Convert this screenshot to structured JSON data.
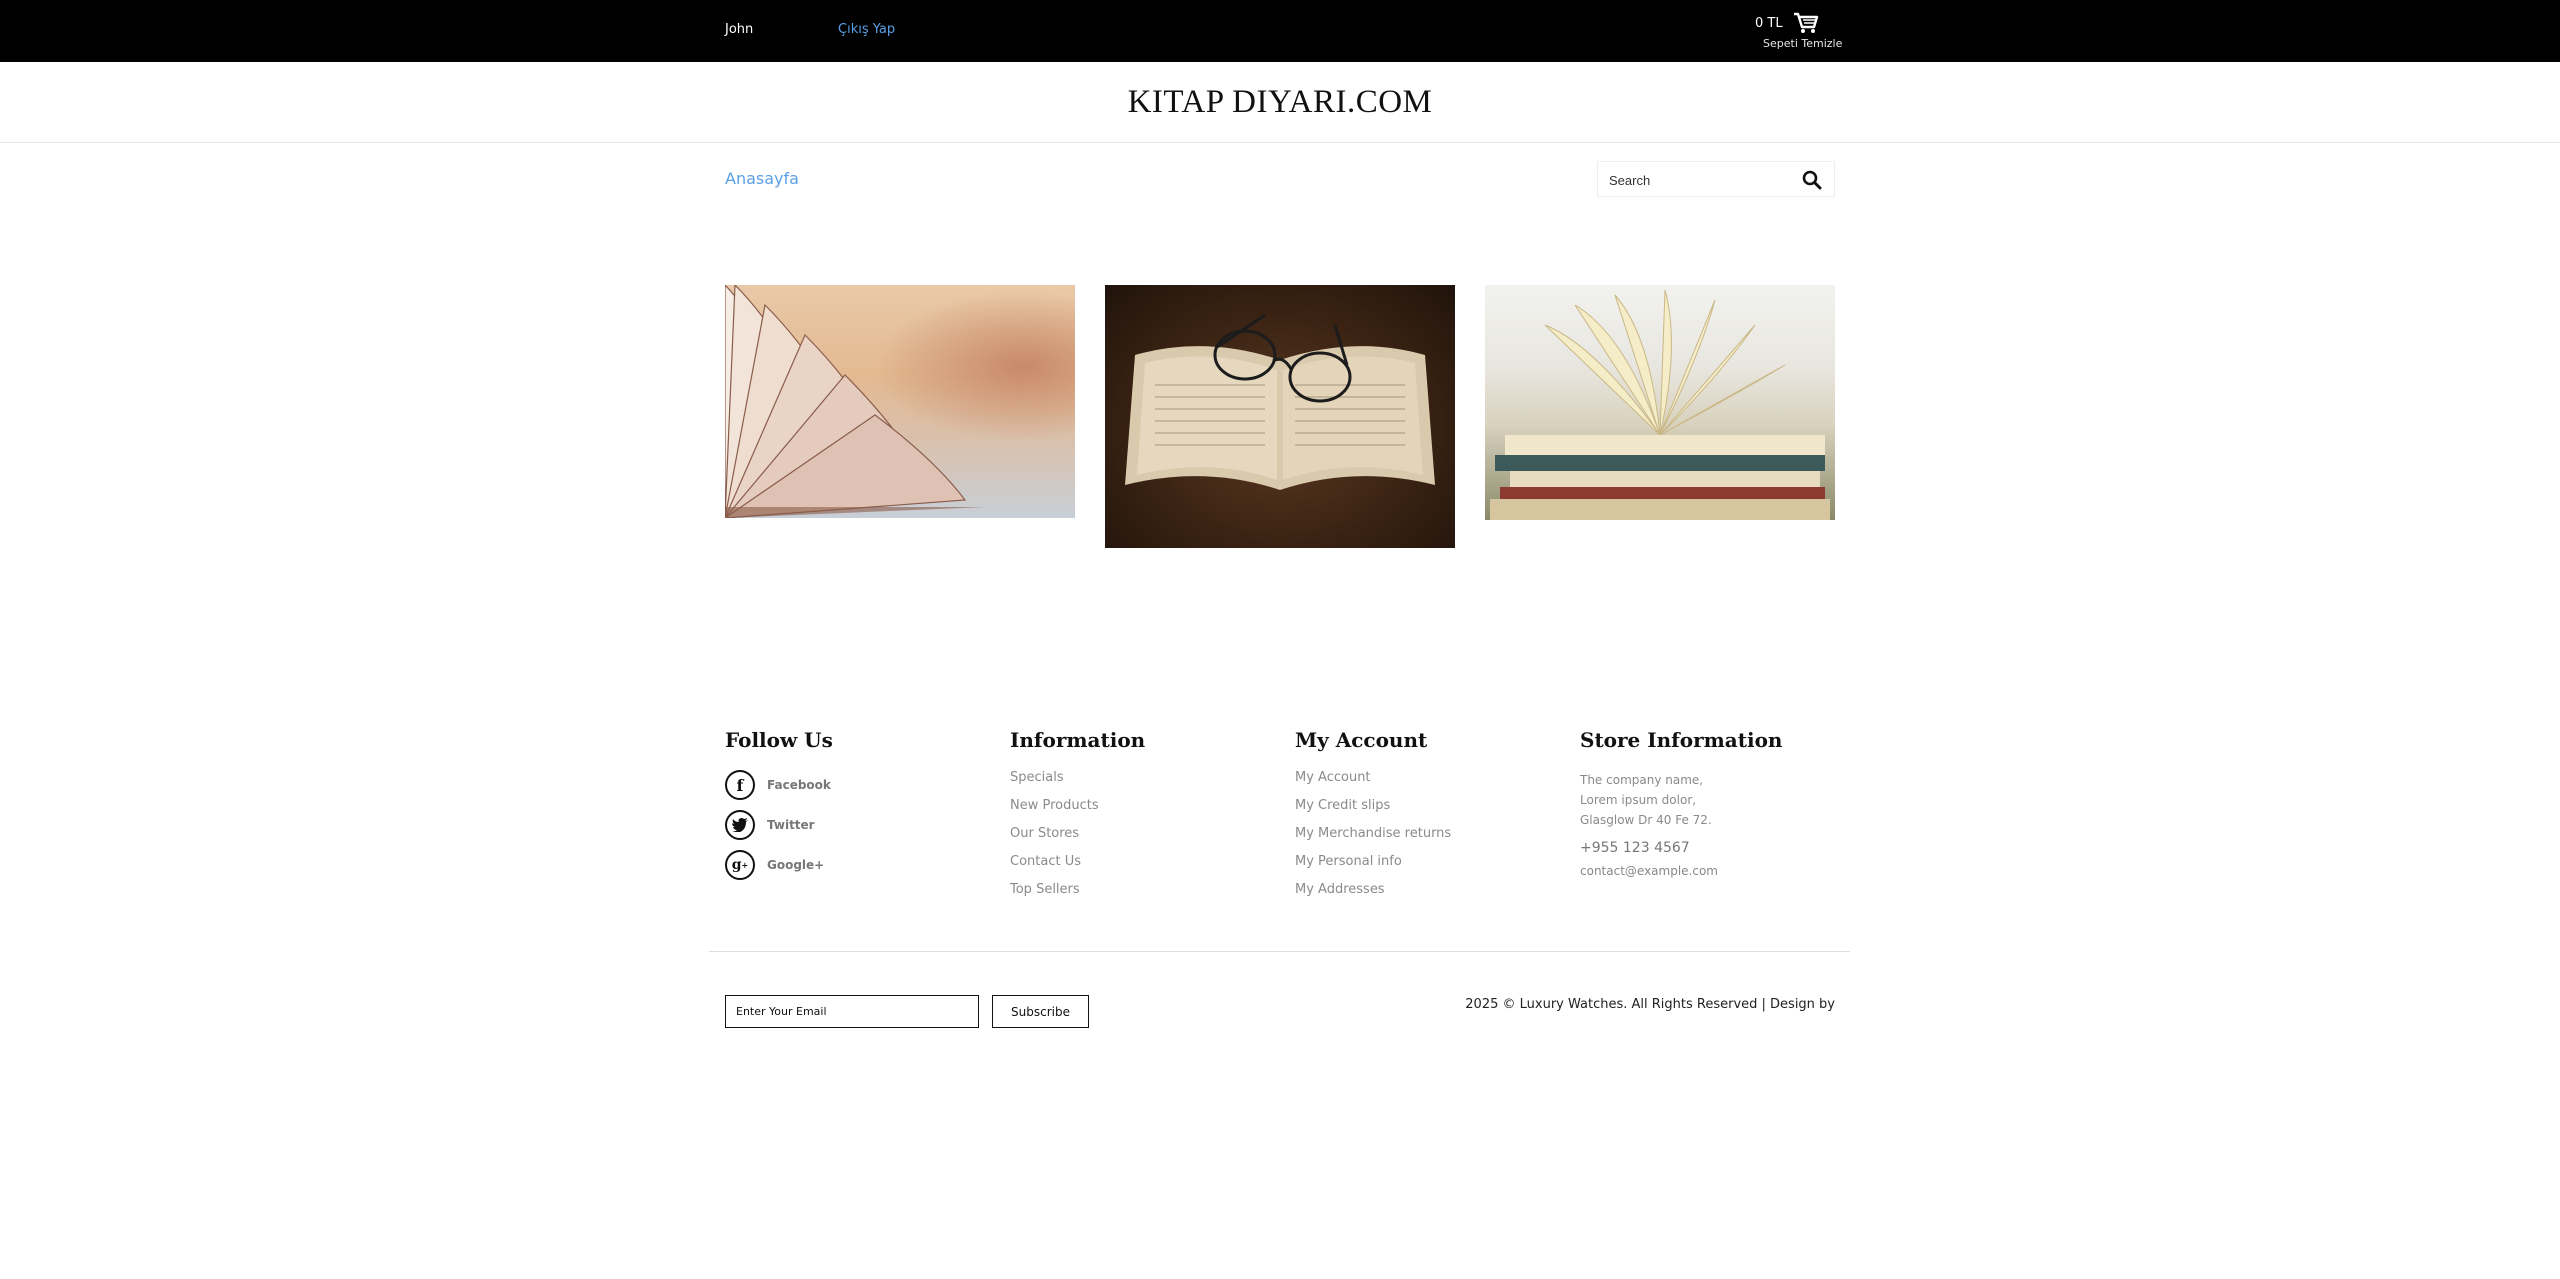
{
  "topbar": {
    "user_name": "John",
    "logout_label": "Çıkış Yap",
    "cart_total": "0 TL",
    "cart_clear_label": "Sepeti Temizle"
  },
  "header": {
    "brand": "KITAP DIYARI.COM"
  },
  "nav": {
    "home_label": "Anasayfa",
    "search_placeholder": "Search"
  },
  "footer": {
    "follow_us": {
      "title": "Follow Us",
      "items": [
        {
          "label": "Facebook",
          "icon": "facebook-icon"
        },
        {
          "label": "Twitter",
          "icon": "twitter-icon"
        },
        {
          "label": "Google+",
          "icon": "google-plus-icon"
        }
      ]
    },
    "information": {
      "title": "Information",
      "links": [
        "Specials",
        "New Products",
        "Our Stores",
        "Contact Us",
        "Top Sellers"
      ]
    },
    "my_account": {
      "title": "My Account",
      "links": [
        "My Account",
        "My Credit slips",
        "My Merchandise returns",
        "My Personal info",
        "My Addresses"
      ]
    },
    "store_info": {
      "title": "Store Information",
      "address_lines": [
        "The company name,",
        "Lorem ipsum dolor,",
        "Glasglow Dr 40 Fe 72."
      ],
      "phone": "+955 123 4567",
      "email": "contact@example.com"
    },
    "newsletter": {
      "email_placeholder": "Enter Your Email",
      "subscribe_label": "Subscribe"
    },
    "copyright": "2025 © Luxury Watches. All Rights Reserved | Design by"
  }
}
